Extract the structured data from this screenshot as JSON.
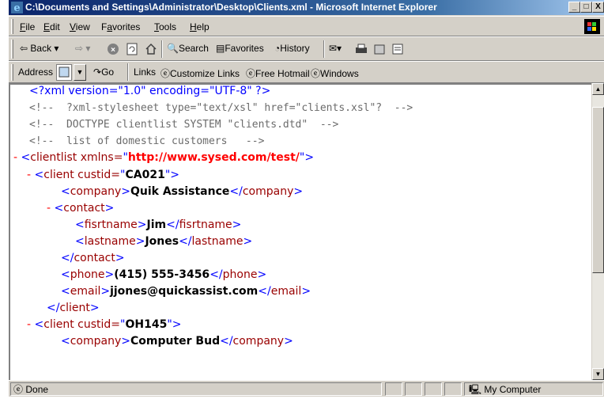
{
  "window": {
    "title": "C:\\Documents and Settings\\Administrator\\Desktop\\Clients.xml - Microsoft Internet Explorer",
    "min": "_",
    "max": "□",
    "close": "X"
  },
  "menu": [
    {
      "label": "File",
      "key": "F",
      "rest": "ile"
    },
    {
      "label": "Edit",
      "key": "E",
      "rest": "dit"
    },
    {
      "label": "View",
      "key": "V",
      "rest": "iew"
    },
    {
      "label": "Favorites",
      "pre": "F",
      "key": "a",
      "rest": "vorites"
    },
    {
      "label": "Tools",
      "key": "T",
      "rest": "ools"
    },
    {
      "label": "Help",
      "key": "H",
      "rest": "elp"
    }
  ],
  "toolbar": {
    "back": "Back",
    "search": "Search",
    "favorites": "Favorites",
    "history": "History"
  },
  "address": {
    "label": "Address",
    "go": "Go",
    "links": "Links",
    "customize": "Customize Links",
    "hotmail": "Free Hotmail",
    "windows": "Windows"
  },
  "xml": {
    "decl": "<?xml version=\"1.0\" encoding=\"UTF-8\" ?>",
    "comment1": "<!--  ?xml-stylesheet type=\"text/xsl\" href=\"clients.xsl\"?  -->",
    "comment2": "<!--  DOCTYPE clientlist SYSTEM \"clients.dtd\"  -->",
    "comment3": "<!--  list of domestic customers   -->",
    "clientlist_ns": "http://www.sysed.com/test/",
    "client1_id": "CA021",
    "company1": "Quik Assistance",
    "firstname": "Jim",
    "lastname": "Jones",
    "phone": "(415) 555-3456",
    "email": "jjones@quickassist.com",
    "client2_id": "OH145",
    "company2": "Computer Bud"
  },
  "status": {
    "left": "Done",
    "zone": "My Computer"
  }
}
